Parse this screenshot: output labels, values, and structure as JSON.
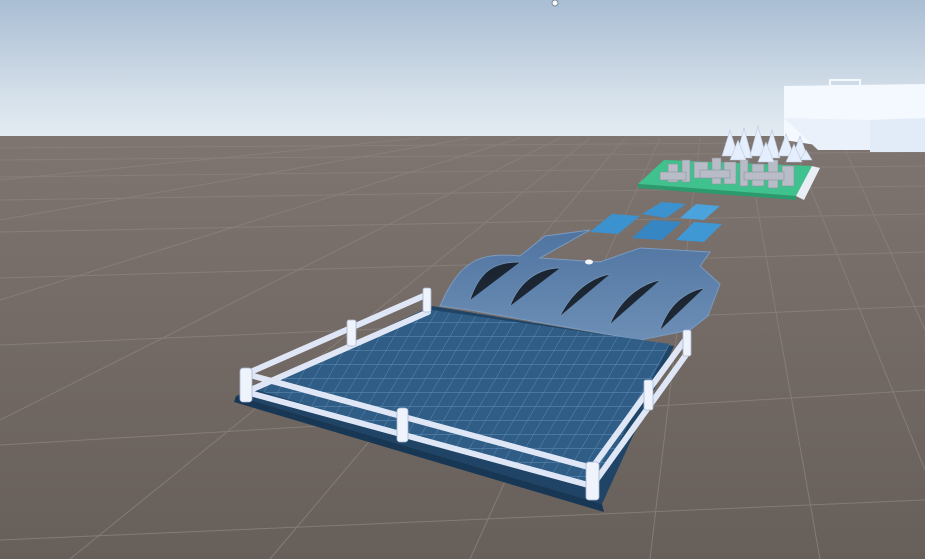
{
  "scene": {
    "view": "3d-game-viewport",
    "colors": {
      "sky_top": "#a9bdd3",
      "sky_horizon": "#e4ecf2",
      "ground": "#6b625d",
      "grid_line": "#8a827d",
      "floor_tile": "#2f5d86",
      "floor_dark": "#1f4466",
      "ramp": "#5e85ad",
      "fence": "#dfe7f7",
      "tile_blue": "#3b92cf",
      "green_base": "#3fc28e",
      "maze_gray": "#b7bcc6",
      "spike": "#e5eefc",
      "distant_block": "#f4f8ff"
    },
    "icons": [
      "sun-icon"
    ],
    "objects": [
      "fenced-start-platform",
      "blue-ramp",
      "floating-blue-tiles",
      "spike-maze-platform",
      "distant-white-structure"
    ]
  }
}
